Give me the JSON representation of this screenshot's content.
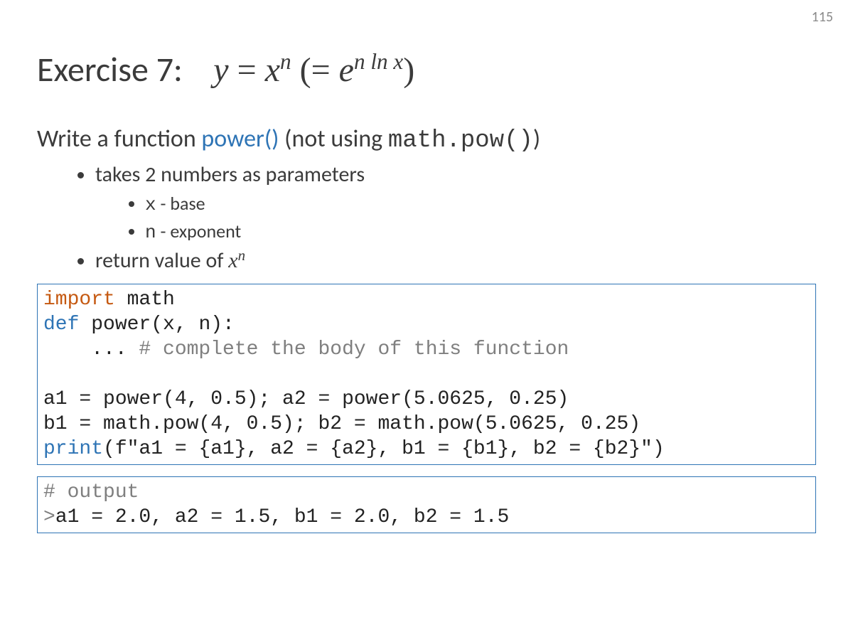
{
  "page_number": "115",
  "title": {
    "prefix": "Exercise 7:",
    "eq_lhs": "y",
    "eq_eq1": "=",
    "eq_xn_base": "x",
    "eq_xn_exp": "n",
    "eq_open": "(=",
    "eq_e": "e",
    "eq_e_exp": "n ln x",
    "eq_close": ")"
  },
  "intro": {
    "pre": "Write a function ",
    "fn": "power()",
    "mid": " (not using ",
    "mono": "math.pow()",
    "post": ")"
  },
  "bullets": {
    "b1": "takes 2 numbers as parameters",
    "b1a_code": "x",
    "b1a_rest": " - base",
    "b1b_code": "n",
    "b1b_rest": " - exponent",
    "b2_pre": "return value of ",
    "b2_math_base": "x",
    "b2_math_exp": "n"
  },
  "code1": {
    "l1_kw": "import",
    "l1_rest": " math",
    "l2_kw": "def",
    "l2_rest": " power(x, n):",
    "l3_indent": "    ... ",
    "l3_cmt": "# complete the body of this function",
    "blank": "",
    "l5": "a1 = power(4, 0.5); a2 = power(5.0625, 0.25)",
    "l6": "b1 = math.pow(4, 0.5); b2 = math.pow(5.0625, 0.25)",
    "l7_kw": "print",
    "l7_rest": "(f\"a1 = {a1}, a2 = {a2}, b1 = {b1}, b2 = {b2}\")"
  },
  "code2": {
    "l1_cmt": "# output",
    "l2_prompt": ">",
    "l2_rest": "a1 = 2.0, a2 = 1.5, b1 = 2.0, b2 = 1.5"
  }
}
